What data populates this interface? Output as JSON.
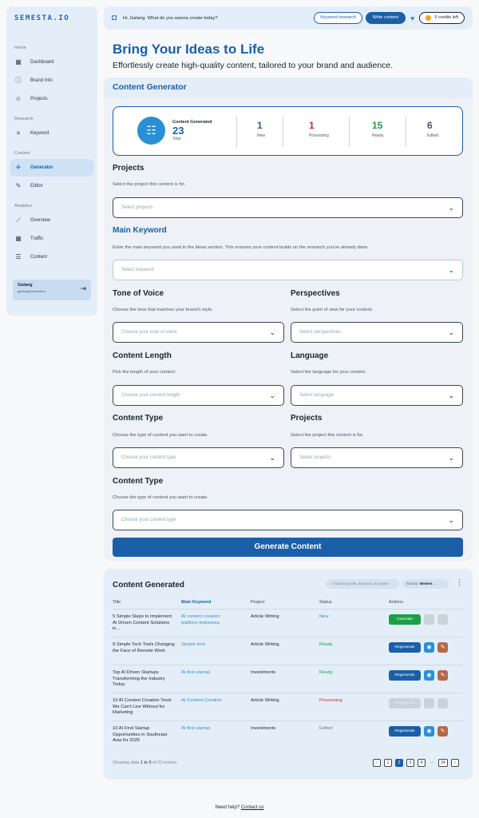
{
  "app": {
    "logo": "SEMESTA.IO"
  },
  "sidebar": {
    "sections": [
      {
        "label": "Home",
        "items": [
          {
            "label": "Dashboard",
            "icon": "grid-icon"
          },
          {
            "label": "Brand Info",
            "icon": "info-icon"
          },
          {
            "label": "Projects",
            "icon": "users-icon"
          }
        ]
      },
      {
        "label": "Research",
        "items": [
          {
            "label": "Keyword",
            "icon": "keyword-icon"
          }
        ]
      },
      {
        "label": "Content",
        "items": [
          {
            "label": "Generator",
            "icon": "magic-wand-icon",
            "active": true
          },
          {
            "label": "Editor",
            "icon": "pencil-icon"
          }
        ]
      },
      {
        "label": "Analytics",
        "items": [
          {
            "label": "Overview",
            "icon": "line-chart-icon"
          },
          {
            "label": "Traffic",
            "icon": "grid-icon"
          },
          {
            "label": "Content",
            "icon": "document-icon"
          }
        ]
      }
    ],
    "user": {
      "name": "Galang",
      "email": "galang@semesta.io"
    }
  },
  "header": {
    "greeting": "Hi, Galang. What do you wanna create today?",
    "keyword_research": "Keyword research",
    "write_content": "Write content",
    "credits": "5 credits left"
  },
  "page": {
    "title": "Bring Your Ideas to Life",
    "subtitle": "Effortlessly create high-quality content, tailored to your brand and audience."
  },
  "generator": {
    "heading": "Content Generator",
    "stats": {
      "main_label": "Content Generated",
      "main_value": "23",
      "main_sub": "Total",
      "items": [
        {
          "value": "1",
          "label": "New",
          "color": "#1b5fa8"
        },
        {
          "value": "1",
          "label": "Processing",
          "color": "#d12a2a"
        },
        {
          "value": "15",
          "label": "Ready",
          "color": "#1aa046"
        },
        {
          "value": "6",
          "label": "Edited",
          "color": "#4a5766"
        }
      ]
    },
    "projects": {
      "title": "Projects",
      "desc": "Select the project this content is for.",
      "placeholder": "Select projects"
    },
    "keyword": {
      "title": "Main Keyword",
      "desc": "Enter the main keyword you used in the Ideas section. This ensures your content builds on the research you've already done.",
      "placeholder": "Select keyword"
    },
    "tone": {
      "title": "Tone of Voice",
      "desc": "Choose the tone that matches your brand's style.",
      "placeholder": "Choose your tone of voice"
    },
    "perspectives": {
      "title": "Perspectives",
      "desc": "Select the point of view for your content.",
      "placeholder": "Select perspectives"
    },
    "length": {
      "title": "Content Length",
      "desc": "Pick the length of your content.",
      "placeholder": "Choose your content length"
    },
    "language": {
      "title": "Language",
      "desc": "Select the language for your content.",
      "placeholder": "Select language"
    },
    "type1": {
      "title": "Content Type",
      "desc": "Choose the type of content you want to create.",
      "placeholder": "Choose your content type"
    },
    "projects2": {
      "title": "Projects",
      "desc": "Select the project this content is for.",
      "placeholder": "Select projects"
    },
    "type2": {
      "title": "Content Type",
      "desc": "Choose the type of content you want to create.",
      "placeholder": "Choose your content type"
    },
    "button": "Generate Content"
  },
  "table": {
    "title": "Content Generated",
    "search_placeholder": "Search by title, keyword, or project",
    "sort_label": "Sort by:",
    "sort_value": "Newest",
    "columns": [
      "Title",
      "Main Keyword",
      "Project",
      "Status",
      "Actions"
    ],
    "rows": [
      {
        "title": "5 Simple Steps to Implement AI Driven Content Solutions in...",
        "keyword": "AI content creation platform Indonesia",
        "project": "Article Writing",
        "status": "New",
        "action": "Generate"
      },
      {
        "title": "9 Simple Tech Tools Changing the Face of Remote Work",
        "keyword": "Simple tech",
        "project": "Article Writing",
        "status": "Ready",
        "action": "Regenerate"
      },
      {
        "title": "Top AI Driven Startups Transforming the Industry Today",
        "keyword": "AI-first startup",
        "project": "Investments",
        "status": "Ready",
        "action": "Regenerate"
      },
      {
        "title": "10 AI Content Creation Tools We Can't Live Without for Marketing",
        "keyword": "AI Content Creation",
        "project": "Article Writing",
        "status": "Processing",
        "action": "Regenerate"
      },
      {
        "title": "10 AI First Startup Opportunities in Southeast Asia for 2025",
        "keyword": "AI-first startup",
        "project": "Investments",
        "status": "Edited",
        "action": "Regenerate"
      }
    ],
    "showing_prefix": "Showing data",
    "showing_range": "1 to 5",
    "showing_suffix": "of 23 entries",
    "pages": [
      "1",
      "2",
      "3",
      "4",
      "...",
      "24"
    ]
  },
  "footer": {
    "help": "Need help?",
    "contact": "Contact us"
  }
}
